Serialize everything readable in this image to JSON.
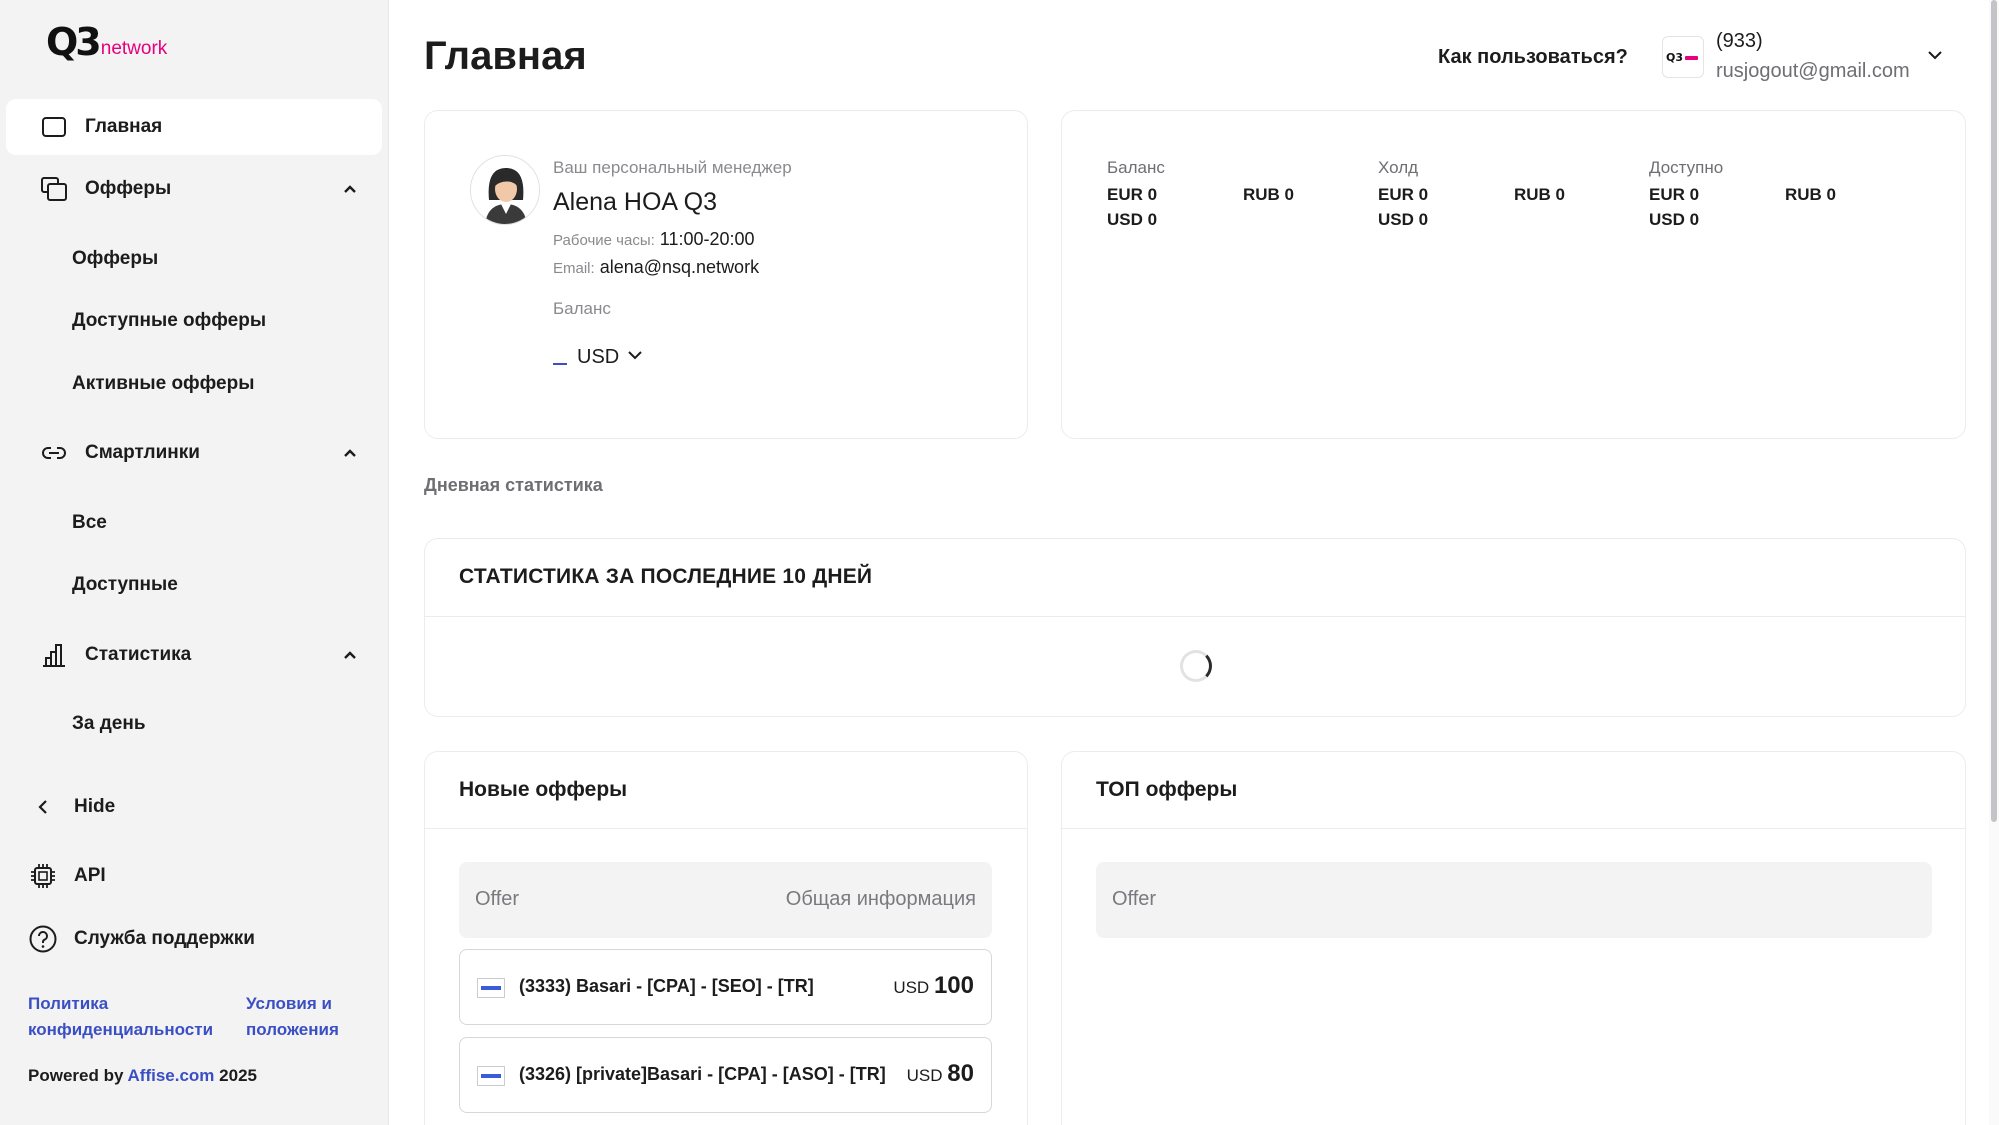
{
  "brand": {
    "mark": "Q3",
    "suffix": "network"
  },
  "sidebar": {
    "home": "Главная",
    "offers": {
      "label": "Офферы",
      "sub": [
        "Офферы",
        "Доступные офферы",
        "Активные офферы"
      ]
    },
    "smartlinks": {
      "label": "Смартлинки",
      "sub": [
        "Все",
        "Доступные"
      ]
    },
    "stats": {
      "label": "Статистика",
      "sub": [
        "За день"
      ]
    },
    "hide": "Hide",
    "api": "API",
    "support": "Служба поддержки",
    "privacy_1": "Политика",
    "privacy_2": "конфиденциальности",
    "terms_1": "Условия и",
    "terms_2": "положения",
    "powered_prefix": "Powered by",
    "powered_link": "Affise.com",
    "powered_year": "2025"
  },
  "header": {
    "title": "Главная",
    "help": "Как пользоваться?",
    "user_id": "(933)",
    "user_email": "rusjogout@gmail.com"
  },
  "manager": {
    "caption": "Ваш персональный менеджер",
    "name": "Alena HOA Q3",
    "hours_key": "Рабочие часы:",
    "hours_val": "11:00-20:00",
    "email_key": "Email:",
    "email_val": "alena@nsq.network",
    "balance_label": "Баланс",
    "currency": "USD"
  },
  "balances": {
    "balance": {
      "title": "Баланс",
      "eur": "EUR 0",
      "usd": "USD 0",
      "rub": "RUB 0"
    },
    "hold": {
      "title": "Холд",
      "eur": "EUR 0",
      "usd": "USD 0",
      "rub": "RUB 0"
    },
    "available": {
      "title": "Доступно",
      "eur": "EUR 0",
      "usd": "USD 0",
      "rub": "RUB 0"
    }
  },
  "daily_label": "Дневная статистика",
  "stats_title": "СТАТИСТИКА ЗА ПОСЛЕДНИЕ 10 ДНЕЙ",
  "new_offers": {
    "title": "Новые офферы",
    "col_offer": "Offer",
    "col_info": "Общая информация",
    "rows": [
      {
        "name": "(3333) Basari - [CPA] - [SEO] - [TR]",
        "currency": "USD",
        "amount": "100"
      },
      {
        "name": "(3326) [private]Basari - [CPA] - [ASO] - [TR]",
        "currency": "USD",
        "amount": "80"
      }
    ]
  },
  "top_offers": {
    "title": "ТОП офферы",
    "col_offer": "Offer"
  },
  "colors": {
    "accent": "#3b4fc4",
    "brand": "#e6007e",
    "sidebar_bg": "#f3f3f4"
  }
}
